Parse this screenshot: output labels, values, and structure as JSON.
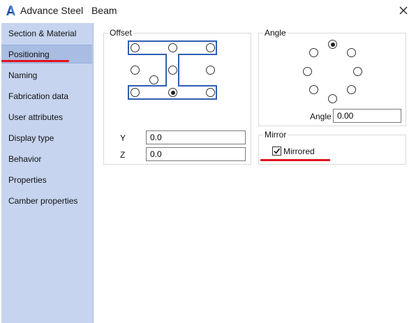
{
  "window": {
    "title": "Advance Steel   Beam",
    "accent_color": "#2f5fb3",
    "sidebar_color": "#c6d4ef",
    "annotation_color": "#e0121f"
  },
  "sidebar": {
    "items": [
      {
        "label": "Section & Material",
        "active": false
      },
      {
        "label": "Positioning",
        "active": true
      },
      {
        "label": "Naming",
        "active": false
      },
      {
        "label": "Fabrication data",
        "active": false
      },
      {
        "label": "User attributes",
        "active": false
      },
      {
        "label": "Display type",
        "active": false
      },
      {
        "label": "Behavior",
        "active": false
      },
      {
        "label": "Properties",
        "active": false
      },
      {
        "label": "Camber properties",
        "active": false
      }
    ]
  },
  "offset": {
    "legend": "Offset",
    "selected_point": "bottom-center",
    "y_label": "Y",
    "y_value": "0.0",
    "z_label": "Z",
    "z_value": "0.0"
  },
  "angle": {
    "legend": "Angle",
    "selected_point": "top",
    "angle_label": "Angle",
    "angle_value": "0.00"
  },
  "mirror": {
    "legend": "Mirror",
    "checkbox_label": "Mirrored",
    "checked": true
  }
}
